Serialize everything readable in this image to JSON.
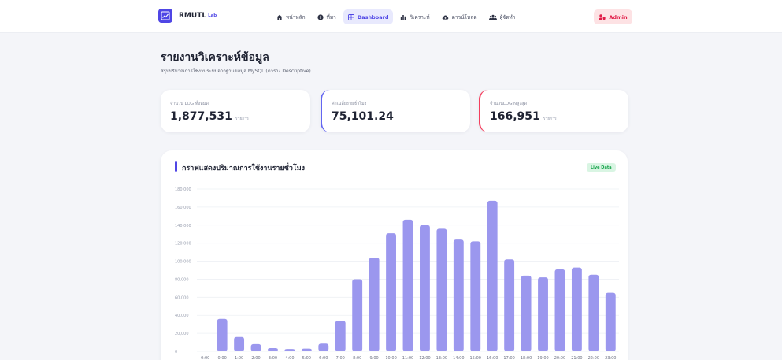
{
  "brand": {
    "name": "RMUTL",
    "sub": "Lab"
  },
  "nav": {
    "items": [
      {
        "icon": "home-icon",
        "label": "หน้าหลัก",
        "active": false
      },
      {
        "icon": "info-icon",
        "label": "ที่มา",
        "active": false
      },
      {
        "icon": "grid-icon",
        "label": "Dashboard",
        "active": true
      },
      {
        "icon": "chart-icon",
        "label": "วิเคราะห์",
        "active": false
      },
      {
        "icon": "cloud-download-icon",
        "label": "ดาวน์โหลด",
        "active": false
      },
      {
        "icon": "team-icon",
        "label": "ผู้จัดทำ",
        "active": false
      }
    ],
    "admin_label": "Admin"
  },
  "page": {
    "title": "รายงานวิเคราะห์ข้อมูล",
    "subtitle": "สรุปปริมาณการใช้งานระบบจากฐานข้อมูล MySQL (ตาราง Descriptive)"
  },
  "stats": [
    {
      "label": "จำนวน LOG ทั้งหมด",
      "value": "1,877,531",
      "unit": "รายการ"
    },
    {
      "label": "ค่าเฉลี่ยรายชั่วโมง",
      "value": "75,101.24",
      "unit": ""
    },
    {
      "label": "จำนวนLOGINสูงสุด",
      "value": "166,951",
      "unit": "รายการ"
    }
  ],
  "chart_card": {
    "title": "กราฟแสดงปริมาณการใช้งานรายชั่วโมง",
    "badge": "Live Data"
  },
  "colors": {
    "primary": "#4f46e5",
    "bar": "#9b97ee",
    "admin_bg": "#fde2e4",
    "admin_text": "#e11d48",
    "live_bg": "#d9f5e3",
    "live_text": "#15a34a"
  },
  "chart_data": {
    "type": "bar",
    "title": "กราฟแสดงปริมาณการใช้งานรายชั่วโมง",
    "xlabel": "",
    "ylabel": "",
    "categories": [
      "0:00",
      "0:00",
      "1:00",
      "2:00",
      "3:00",
      "4:00",
      "5:00",
      "6:00",
      "7:00",
      "8:00",
      "9:00",
      "10:00",
      "11:00",
      "12:00",
      "13:00",
      "14:00",
      "15:00",
      "16:00",
      "17:00",
      "18:00",
      "19:00",
      "20:00",
      "21:00",
      "22:00",
      "23:00"
    ],
    "values": [
      0,
      36000,
      16000,
      8000,
      3500,
      2500,
      3000,
      8500,
      34000,
      80000,
      104000,
      131000,
      146000,
      140000,
      136000,
      124000,
      122000,
      166951,
      102000,
      84000,
      82000,
      91000,
      93000,
      85000,
      65000
    ],
    "ylim": [
      0,
      180000
    ],
    "yticks": [
      0,
      20000,
      40000,
      60000,
      80000,
      100000,
      120000,
      140000,
      160000,
      180000
    ],
    "ytick_labels": [
      "0",
      "20,000",
      "40,000",
      "60,000",
      "80,000",
      "100,000",
      "120,000",
      "140,000",
      "160,000",
      "180,000"
    ],
    "grid": true,
    "legend": "none"
  }
}
